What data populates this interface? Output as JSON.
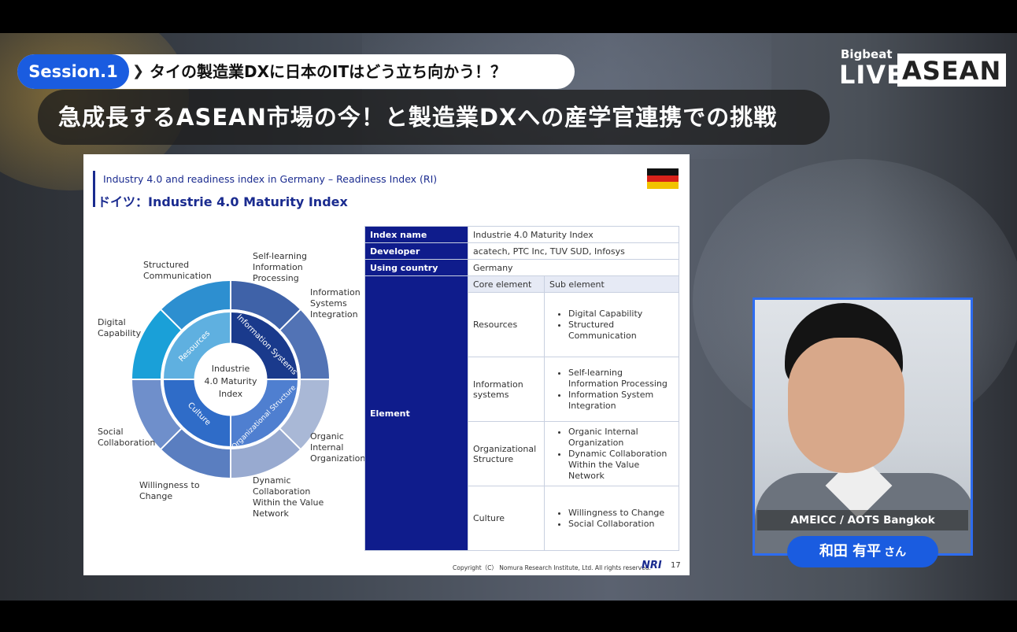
{
  "overlay": {
    "session_tag": "Session.1",
    "session_text": "タイの製造業DXに日本のITはどう立ち向かう！？",
    "main_title": "急成長するASEAN市場の今！と製造業DXへの産学官連携での挑戦",
    "logo_small": "Bigbeat",
    "logo_live": "LIVE",
    "logo_asean": "ASEAN",
    "session_color": "#1a5ce0"
  },
  "slide": {
    "subtitle": "Industry 4.0 and readiness index in Germany – Readiness Index (RI)",
    "title": "ドイツ：Industrie 4.0 Maturity Index",
    "copyright": "Copyright（C） Nomura Research Institute, Ltd. All rights reserved.",
    "logo": "NRI",
    "page": "17",
    "accent_color": "#1a2b8f",
    "ring": {
      "center": [
        "Industrie",
        "4.0 Maturity",
        "Index"
      ],
      "inner": [
        "Information Systems",
        "Organizational Structure",
        "Culture",
        "Resources"
      ],
      "outer_labels": [
        [
          "Structured",
          "Communication"
        ],
        [
          "Self-learning",
          "Information",
          "Processing"
        ],
        [
          "Information",
          "Systems",
          "Integration"
        ],
        [
          "Digital",
          "Capability"
        ],
        [
          "Social",
          "Collaboration"
        ],
        [
          "Organic",
          "Internal",
          "Organization"
        ],
        [
          "Willingness to",
          "Change"
        ],
        [
          "Dynamic",
          "Collaboration",
          "Within the Value",
          "Network"
        ]
      ]
    },
    "table": {
      "rows": [
        {
          "label": "Index name",
          "value": "Industrie 4.0 Maturity Index"
        },
        {
          "label": "Developer",
          "value": "acatech, PTC Inc, TUV SUD, Infosys"
        },
        {
          "label": "Using country",
          "value": "Germany"
        }
      ],
      "element_label": "Element",
      "col_core": "Core element",
      "col_sub": "Sub element",
      "elements": [
        {
          "core": "Resources",
          "subs": [
            "Digital Capability",
            "Structured Communication"
          ]
        },
        {
          "core": "Information systems",
          "subs": [
            "Self-learning Information Processing",
            "Information System Integration"
          ]
        },
        {
          "core": "Organizational Structure",
          "subs": [
            "Organic Internal Organization",
            "Dynamic Collaboration Within the Value Network"
          ]
        },
        {
          "core": "Culture",
          "subs": [
            "Willingness to Change",
            "Social Collaboration"
          ]
        }
      ]
    }
  },
  "camera": {
    "org": "AMEICC / AOTS Bangkok",
    "name": "和田 有平",
    "suffix": "さん"
  }
}
